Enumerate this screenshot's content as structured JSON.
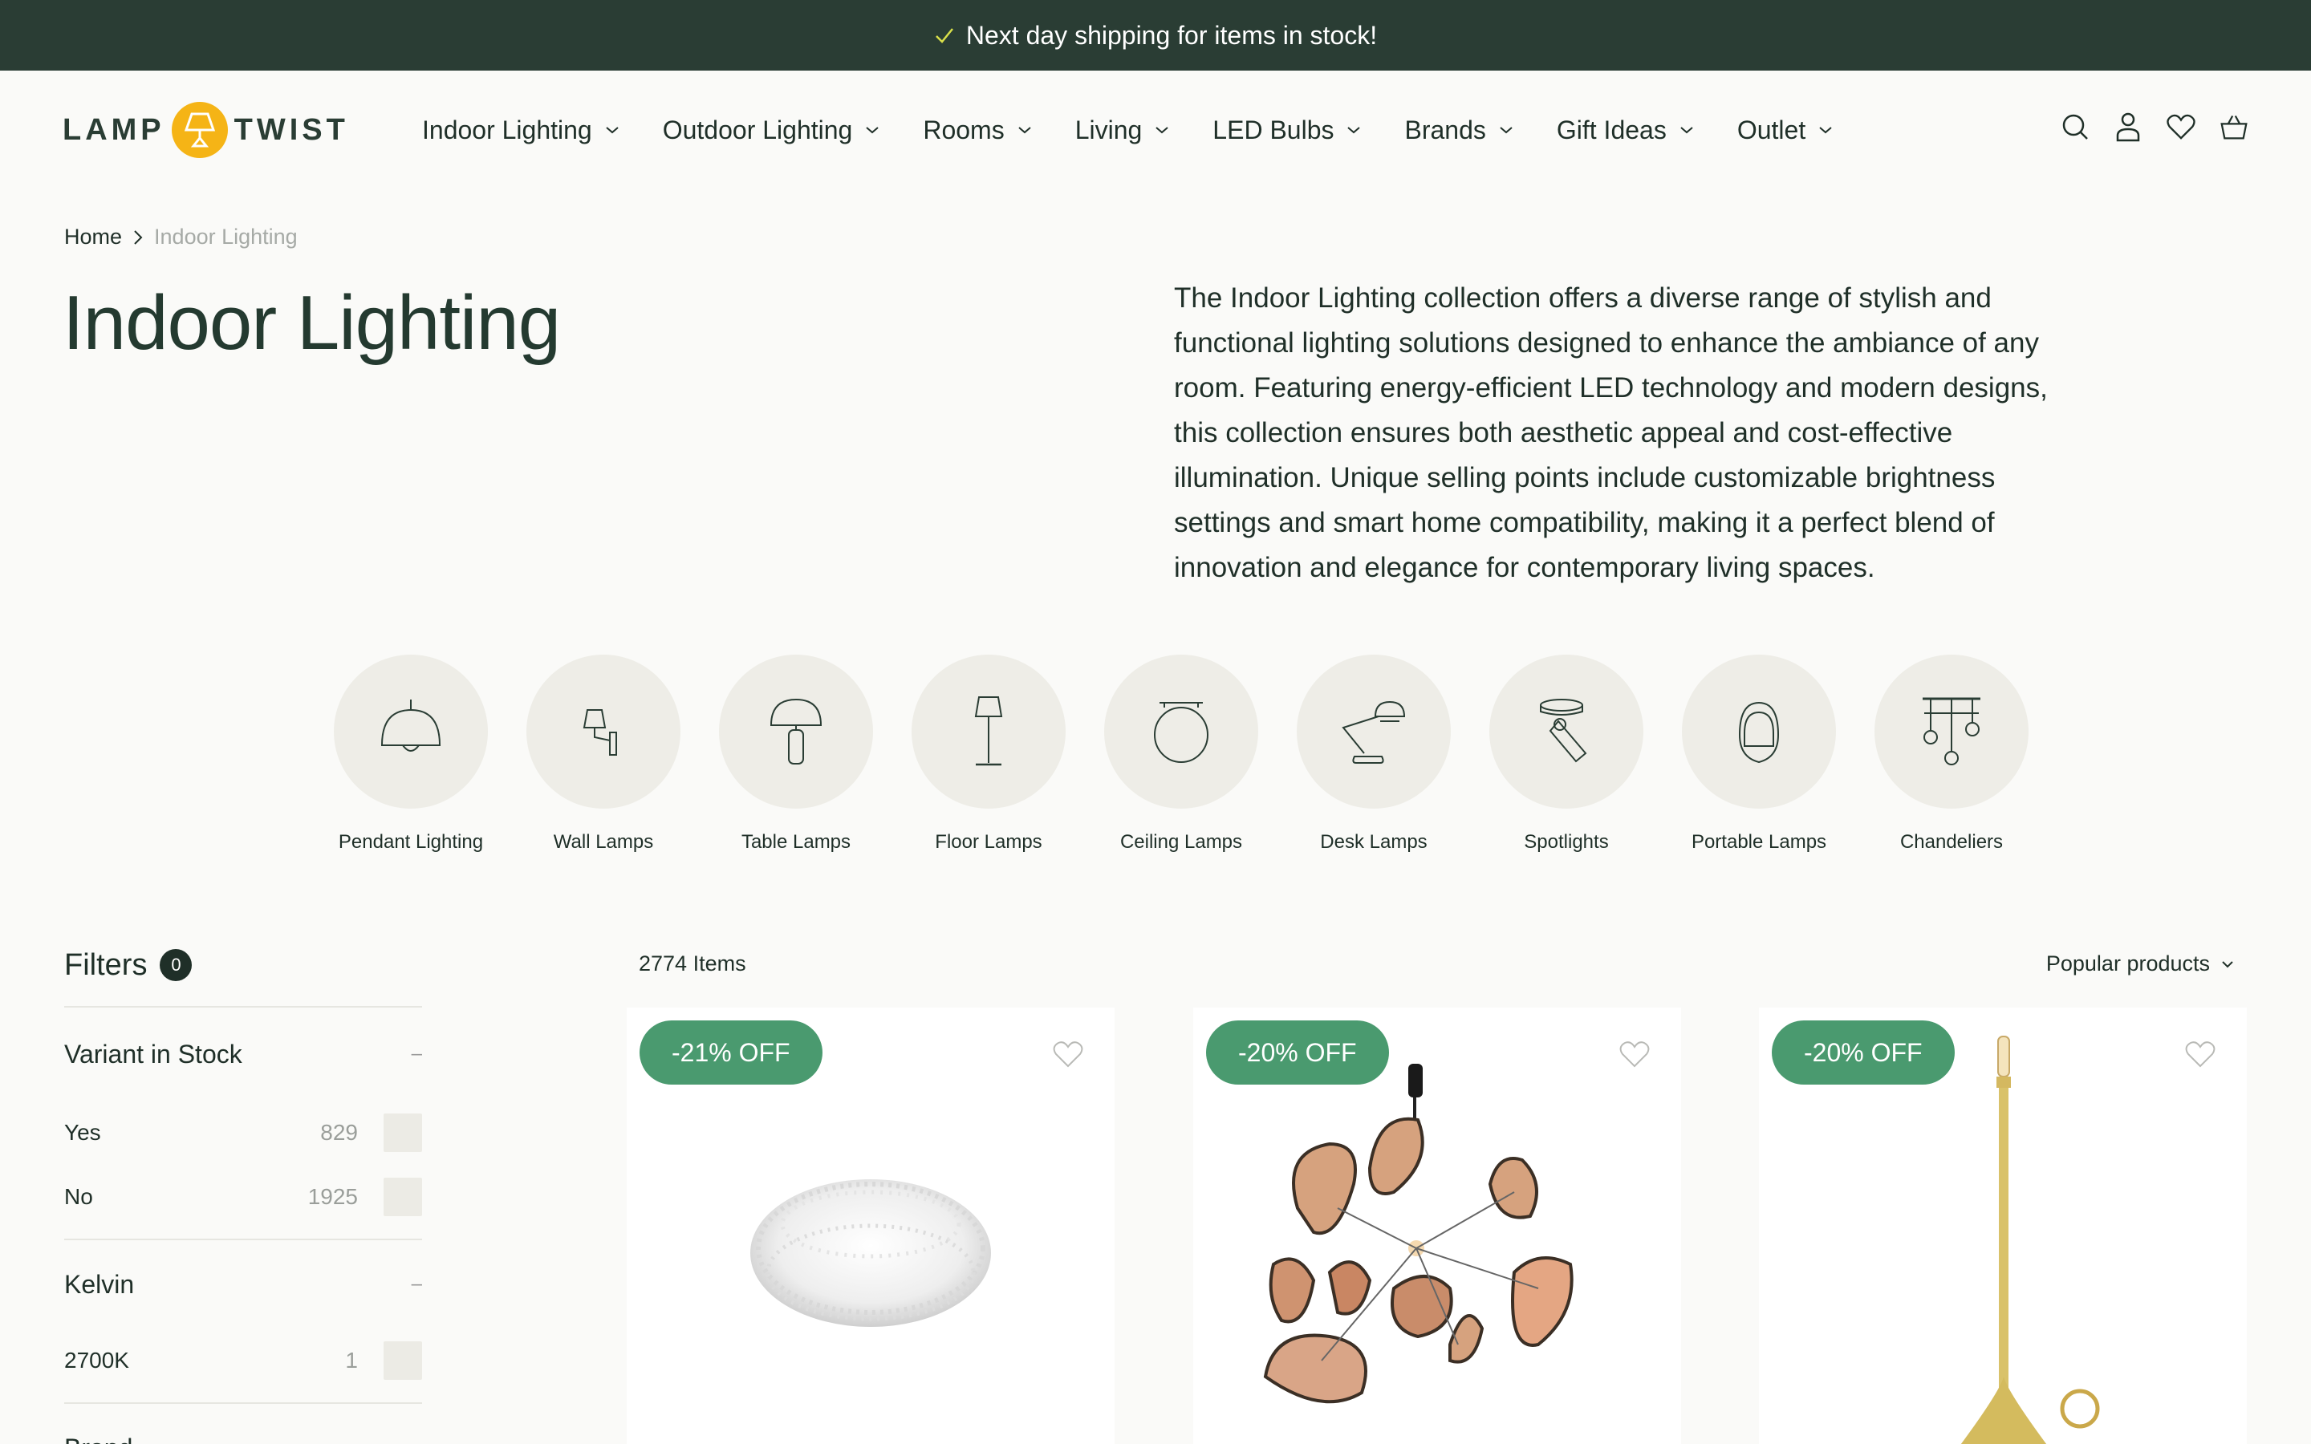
{
  "topbar": {
    "message": "Next day shipping for items in stock!"
  },
  "logo": {
    "left": "LAMP",
    "right": "TWIST"
  },
  "nav": [
    "Indoor Lighting",
    "Outdoor Lighting",
    "Rooms",
    "Living",
    "LED Bulbs",
    "Brands",
    "Gift Ideas",
    "Outlet"
  ],
  "header_icons": [
    "search-icon",
    "account-icon",
    "wishlist-icon",
    "cart-icon"
  ],
  "breadcrumb": {
    "home": "Home",
    "current": "Indoor Lighting"
  },
  "page": {
    "title": "Indoor Lighting",
    "description": "The Indoor Lighting collection offers a diverse range of stylish and functional lighting solutions designed to enhance the ambiance of any room. Featuring energy-efficient LED technology and modern designs, this collection ensures both aesthetic appeal and cost-effective illumination. Unique selling points include customizable brightness settings and smart home compatibility, making it a perfect blend of innovation and elegance for contemporary living spaces."
  },
  "categories": [
    "Pendant Lighting",
    "Wall Lamps",
    "Table Lamps",
    "Floor Lamps",
    "Ceiling Lamps",
    "Desk Lamps",
    "Spotlights",
    "Portable Lamps",
    "Chandeliers"
  ],
  "filters": {
    "title": "Filters",
    "active_count": "0",
    "groups": [
      {
        "name": "Variant in Stock",
        "toggle": "–",
        "options": [
          {
            "label": "Yes",
            "count": "829"
          },
          {
            "label": "No",
            "count": "1925"
          }
        ]
      },
      {
        "name": "Kelvin",
        "toggle": "–",
        "options": [
          {
            "label": "2700K",
            "count": "1"
          }
        ]
      },
      {
        "name": "Brand",
        "toggle": "–",
        "options": []
      }
    ]
  },
  "listing": {
    "items_count": "2774 Items",
    "sort_label": "Popular products"
  },
  "products": [
    {
      "badge": "-21% OFF"
    },
    {
      "badge": "-20% OFF"
    },
    {
      "badge": "-20% OFF"
    }
  ],
  "colors": {
    "topbar": "#2a3d34",
    "badge": "#4a9a6f",
    "logo_accent": "#f5b416"
  }
}
